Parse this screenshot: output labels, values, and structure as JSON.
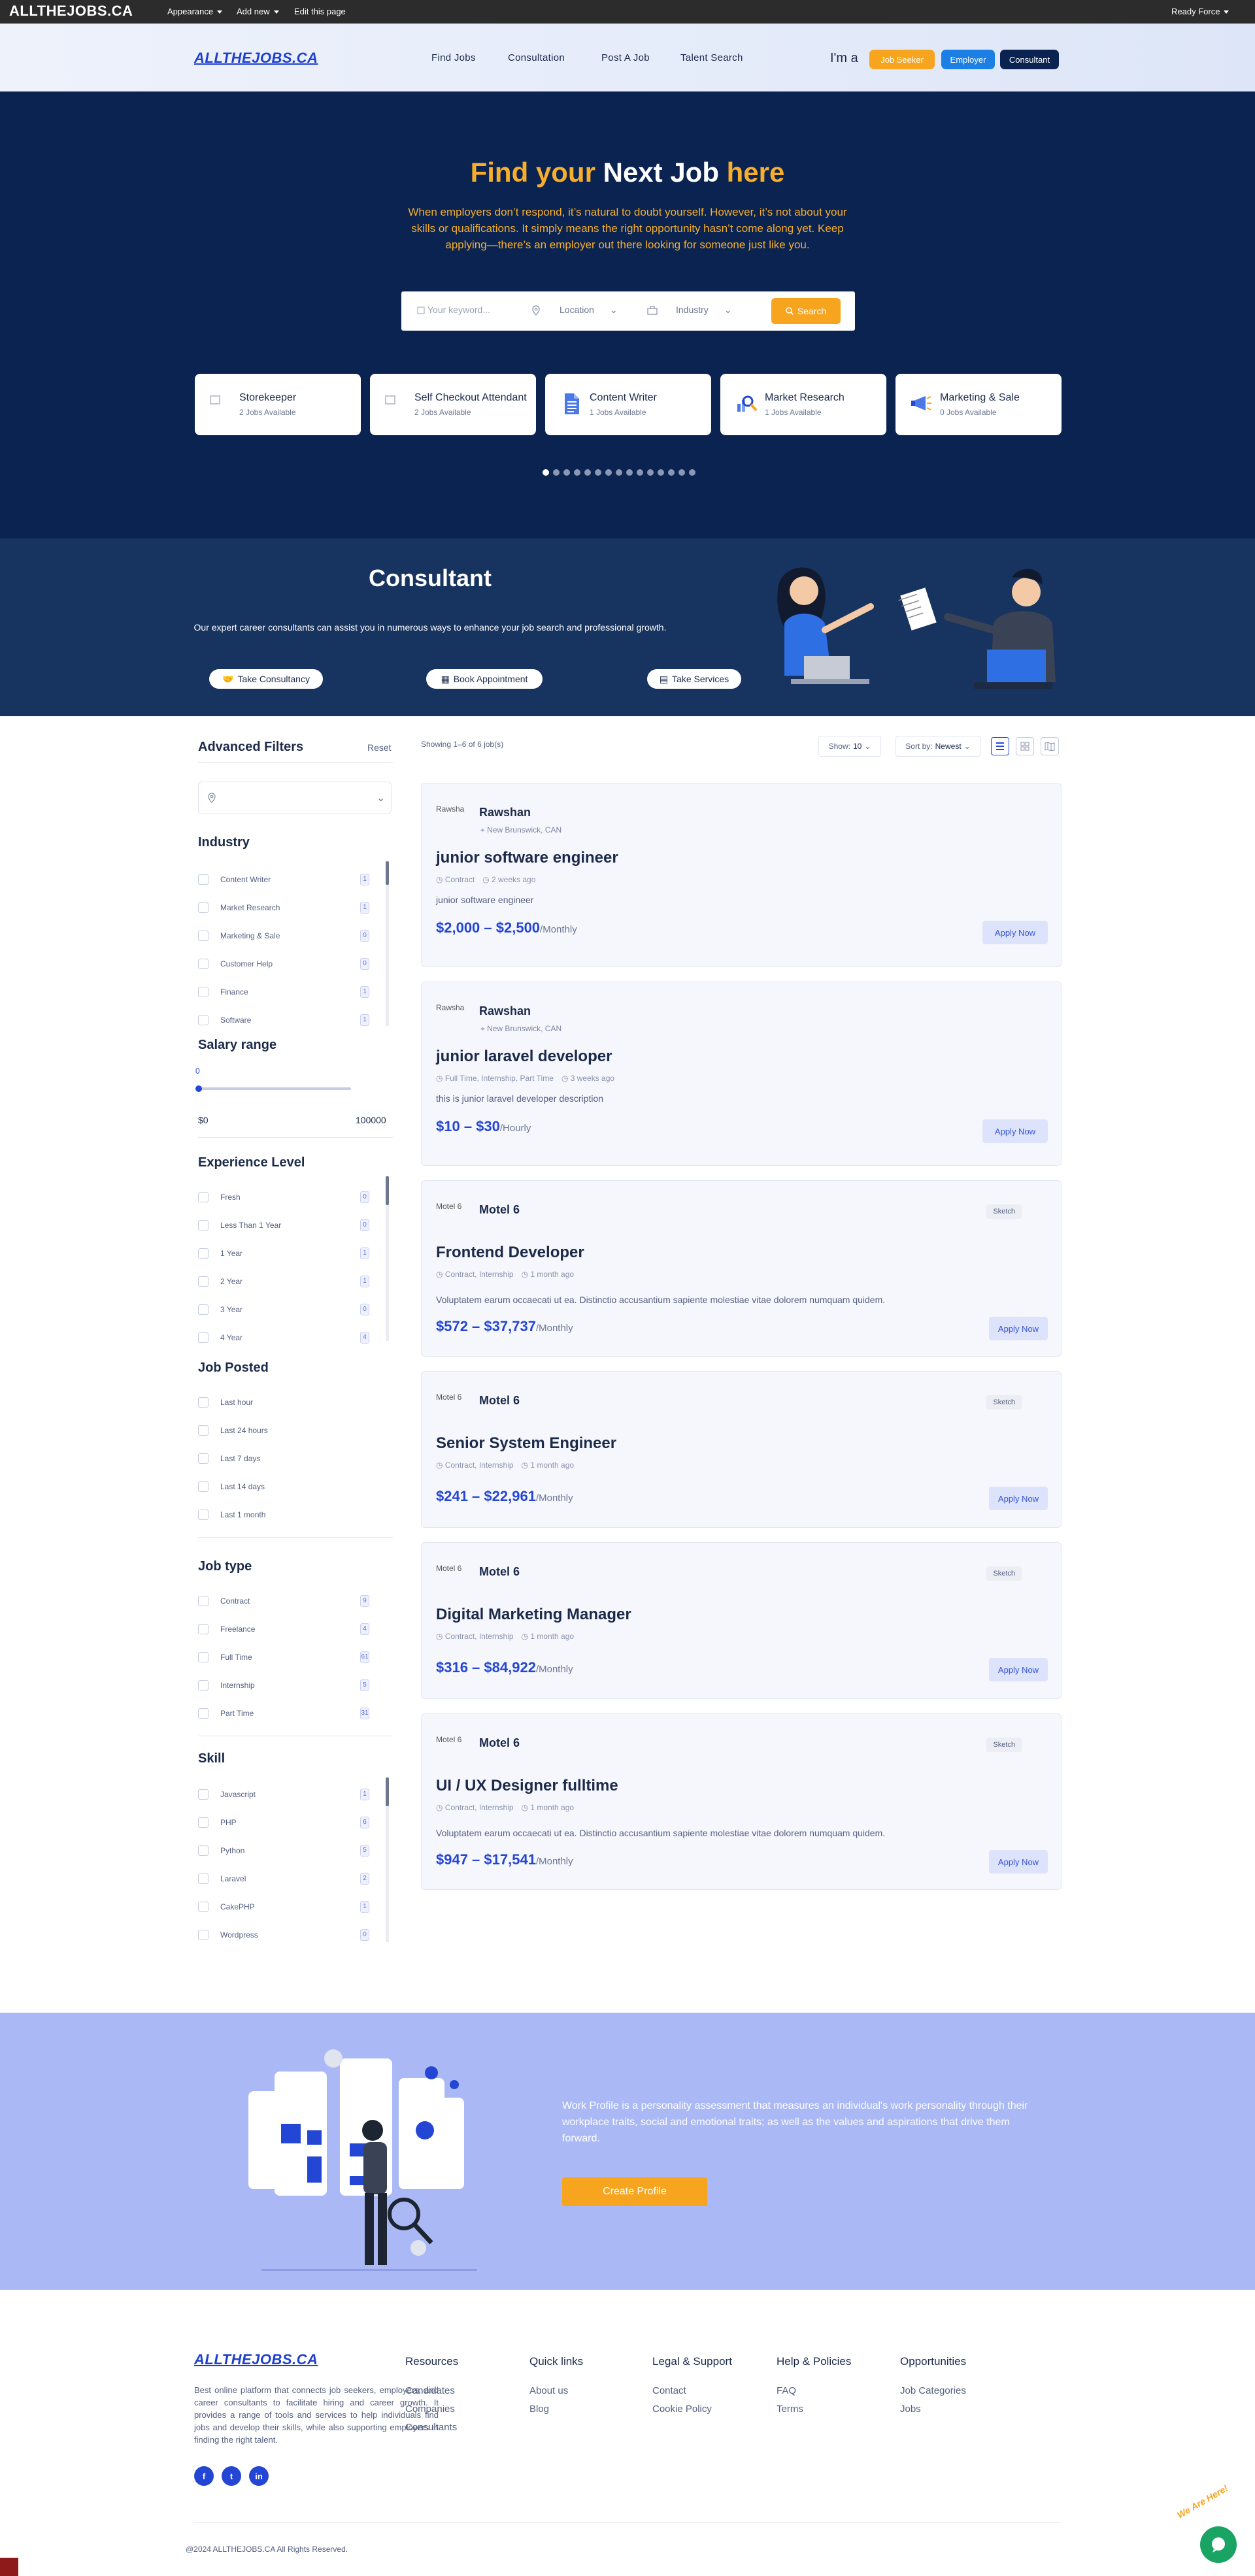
{
  "adminbar": {
    "brand": "ALLTHEJOBS.CA",
    "appearance": "Appearance",
    "add_new": "Add new",
    "edit": "Edit this page",
    "user": "Ready Force"
  },
  "header": {
    "logo": "ALLTHEJOBS.CA",
    "nav": [
      "Find Jobs",
      "Consultation",
      "Post A Job",
      "Talent Search"
    ],
    "im_a": "I'm a",
    "roles": [
      "Job Seeker",
      "Employer",
      "Consultant"
    ]
  },
  "hero": {
    "title_1": "Find your ",
    "title_2": "Next Job",
    "title_3": " here",
    "subtitle": "When employers don’t respond, it’s natural to doubt yourself. However, it’s not about your skills or qualifications. It simply means the right opportunity hasn’t come along yet. Keep applying—there’s an employer out there looking for someone just like you.",
    "keyword_placeholder": "Your keyword...",
    "location_label": "Location",
    "industry_label": "Industry",
    "search_label": "Search",
    "categories": [
      {
        "name": "Storekeeper",
        "count": "2 Jobs Available",
        "icon": "image-icon"
      },
      {
        "name": "Self Checkout Attendant",
        "count": "2 Jobs Available",
        "icon": "image-icon"
      },
      {
        "name": "Content Writer",
        "count": "1 Jobs Available",
        "icon": "document-icon"
      },
      {
        "name": "Market Research",
        "count": "1 Jobs Available",
        "icon": "magnifier-icon"
      },
      {
        "name": "Marketing & Sale",
        "count": "0 Jobs Available",
        "icon": "megaphone-icon"
      }
    ],
    "dots_active": 0
  },
  "consultant": {
    "title": "Consultant",
    "subtitle": "Our expert career consultants can assist you in numerous ways to enhance your job search and professional growth.",
    "buttons": [
      "Take Consultancy",
      "Book Appointment",
      "Take Services"
    ]
  },
  "filters": {
    "title": "Advanced Filters",
    "reset": "Reset",
    "industry_title": "Industry",
    "industry": [
      {
        "label": "Content Writer",
        "count": "1"
      },
      {
        "label": "Market Research",
        "count": "1"
      },
      {
        "label": "Marketing & Sale",
        "count": "0"
      },
      {
        "label": "Customer Help",
        "count": "0"
      },
      {
        "label": "Finance",
        "count": "1"
      },
      {
        "label": "Software",
        "count": "1"
      }
    ],
    "salary_title": "Salary range",
    "salary_value": "0",
    "salary_min": "$0",
    "salary_max": "100000",
    "salary_fraction": 0,
    "experience_title": "Experience Level",
    "experience": [
      {
        "label": "Fresh",
        "count": "0"
      },
      {
        "label": "Less Than 1 Year",
        "count": "0"
      },
      {
        "label": "1 Year",
        "count": "1"
      },
      {
        "label": "2 Year",
        "count": "1"
      },
      {
        "label": "3 Year",
        "count": "0"
      },
      {
        "label": "4 Year",
        "count": "4"
      }
    ],
    "posted_title": "Job Posted",
    "posted": [
      "Last hour",
      "Last 24 hours",
      "Last 7 days",
      "Last 14 days",
      "Last 1 month"
    ],
    "jobtype_title": "Job type",
    "jobtype": [
      {
        "label": "Contract",
        "count": "9"
      },
      {
        "label": "Freelance",
        "count": "4"
      },
      {
        "label": "Full Time",
        "count": "61"
      },
      {
        "label": "Internship",
        "count": "5"
      },
      {
        "label": "Part Time",
        "count": "31"
      }
    ],
    "skill_title": "Skill",
    "skill": [
      {
        "label": "Javascript",
        "count": "1"
      },
      {
        "label": "PHP",
        "count": "6"
      },
      {
        "label": "Python",
        "count": "5"
      },
      {
        "label": "Laravel",
        "count": "2"
      },
      {
        "label": "CakePHP",
        "count": "1"
      },
      {
        "label": "Wordpress",
        "count": "0"
      }
    ]
  },
  "results": {
    "showing": "Showing 1–6 of 6 job(s)",
    "show_label": "Show:",
    "show_value": "10",
    "sort_label": "Sort by:",
    "sort_value": "Newest"
  },
  "jobs": [
    {
      "company": "Rawshan",
      "logo_alt": "Rawsha",
      "location": "New Brunswick, CAN",
      "tag": "",
      "title": "junior software engineer",
      "type": "Contract",
      "time": "2 weeks ago",
      "desc": "junior software engineer",
      "pay": "$2,000 – $2,500",
      "period": "/Monthly",
      "apply": "Apply Now"
    },
    {
      "company": "Rawshan",
      "logo_alt": "Rawsha",
      "location": "New Brunswick, CAN",
      "tag": "",
      "title": "junior laravel developer",
      "type": "Full Time, Internship, Part Time",
      "time": "3 weeks ago",
      "desc": "this is junior laravel developer description",
      "pay": "$10 – $30",
      "period": "/Hourly",
      "apply": "Apply Now"
    },
    {
      "company": "Motel 6",
      "logo_alt": "Motel 6",
      "location": "",
      "tag": "Sketch",
      "title": "Frontend Developer",
      "type": "Contract, Internship",
      "time": "1 month ago",
      "desc": "Voluptatem earum occaecati ut ea. Distinctio accusantium sapiente molestiae vitae dolorem numquam quidem.",
      "pay": "$572 – $37,737",
      "period": "/Monthly",
      "apply": "Apply Now"
    },
    {
      "company": "Motel 6",
      "logo_alt": "Motel 6",
      "location": "",
      "tag": "Sketch",
      "title": "Senior System Engineer",
      "type": "Contract, Internship",
      "time": "1 month ago",
      "desc": "",
      "pay": "$241 – $22,961",
      "period": "/Monthly",
      "apply": "Apply Now"
    },
    {
      "company": "Motel 6",
      "logo_alt": "Motel 6",
      "location": "",
      "tag": "Sketch",
      "title": "Digital Marketing Manager",
      "type": "Contract, Internship",
      "time": "1 month ago",
      "desc": "",
      "pay": "$316 – $84,922",
      "period": "/Monthly",
      "apply": "Apply Now"
    },
    {
      "company": "Motel 6",
      "logo_alt": "Motel 6",
      "location": "",
      "tag": "Sketch",
      "title": "UI / UX Designer fulltime",
      "type": "Contract, Internship",
      "time": "1 month ago",
      "desc": "Voluptatem earum occaecati ut ea. Distinctio accusantium sapiente molestiae vitae dolorem numquam quidem.",
      "pay": "$947 – $17,541",
      "period": "/Monthly",
      "apply": "Apply Now"
    }
  ],
  "profile": {
    "text": "Work Profile is a personality assessment that measures an individual's work personality through their workplace traits, social and emotional traits; as well as the values and aspirations that drive them forward.",
    "button": "Create Profile"
  },
  "footer": {
    "logo": "ALLTHEJOBS.CA",
    "about": "Best online platform that connects job seekers, employers, and career consultants to facilitate hiring and career growth. It provides a range of tools and services to help individuals find jobs and develop their skills, while also supporting employers in finding the right talent.",
    "columns": [
      {
        "title": "Resources",
        "links": [
          "Candidates",
          "Companies",
          "Consultants"
        ]
      },
      {
        "title": "Quick links",
        "links": [
          "About us",
          "Blog"
        ]
      },
      {
        "title": "Legal & Support",
        "links": [
          "Contact",
          "Cookie Policy"
        ]
      },
      {
        "title": "Help & Policies",
        "links": [
          "FAQ",
          "Terms"
        ]
      },
      {
        "title": "Opportunities",
        "links": [
          "Job Categories",
          "Jobs"
        ]
      }
    ],
    "social": [
      "f",
      "t",
      "in"
    ],
    "copyright": "@2024 ALLTHEJOBS.CA All Rights Reserved.",
    "chat_badge": "We Are Here!"
  },
  "colors": {
    "brand": "#1e3fcf",
    "accent": "#f7a51e",
    "hero": "#0a2350",
    "consult": "#17335f",
    "profile": "#aab9f6"
  }
}
